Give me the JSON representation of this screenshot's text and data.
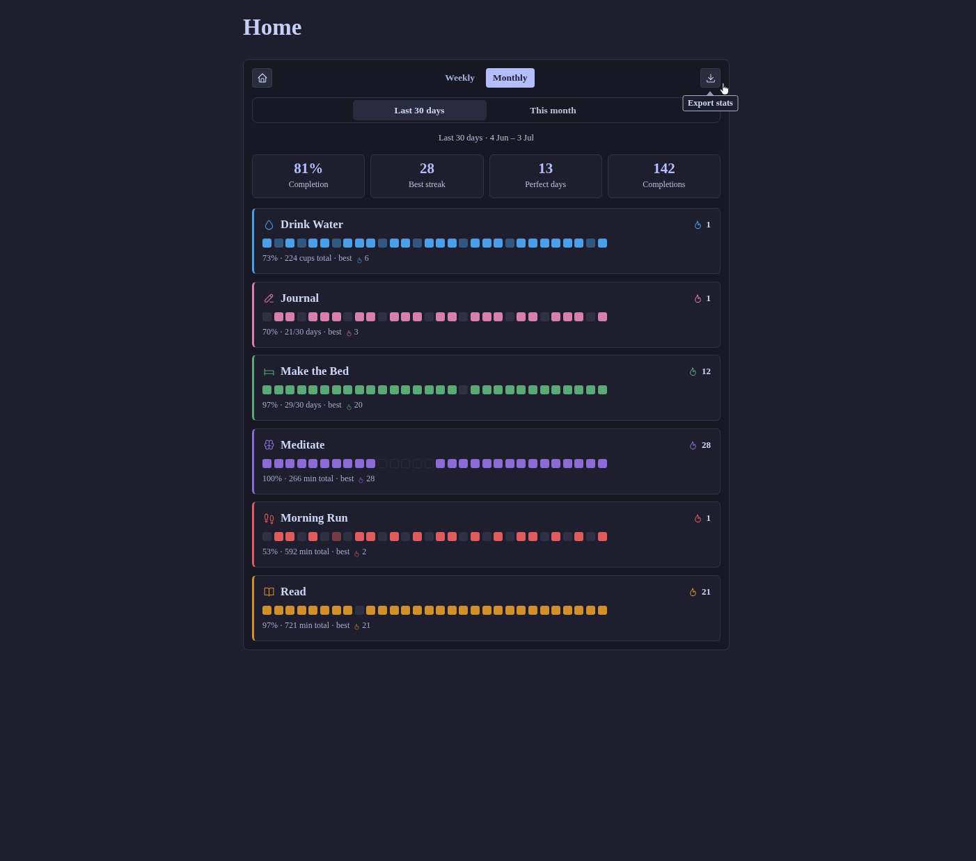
{
  "page": {
    "title": "Home"
  },
  "view_tabs": [
    {
      "label": "Weekly",
      "selected": false
    },
    {
      "label": "Monthly",
      "selected": true
    }
  ],
  "export_tooltip": "Export stats",
  "range_tabs": [
    {
      "label": "Last 30 days",
      "selected": true
    },
    {
      "label": "This month",
      "selected": false
    }
  ],
  "range_caption": "Last 30 days · 4 Jun – 3 Jul",
  "stats": [
    {
      "value": "81%",
      "label": "Completion"
    },
    {
      "value": "28",
      "label": "Best streak"
    },
    {
      "value": "13",
      "label": "Perfect days"
    },
    {
      "value": "142",
      "label": "Completions"
    }
  ],
  "habits": [
    {
      "kind": "drop",
      "name": "Drink Water",
      "color": "#4a9fe8",
      "streak": "1",
      "summary": "73% · 224 cups total · best",
      "best": "6",
      "days": [
        {
          "kind": "done"
        },
        {
          "kind": "partial"
        },
        {
          "kind": "done"
        },
        {
          "kind": "partial"
        },
        {
          "kind": "done"
        },
        {
          "kind": "done"
        },
        {
          "kind": "partial"
        },
        {
          "kind": "done"
        },
        {
          "kind": "done"
        },
        {
          "kind": "done"
        },
        {
          "kind": "partial"
        },
        {
          "kind": "done"
        },
        {
          "kind": "done"
        },
        {
          "kind": "partial"
        },
        {
          "kind": "done"
        },
        {
          "kind": "done"
        },
        {
          "kind": "done"
        },
        {
          "kind": "partial"
        },
        {
          "kind": "done"
        },
        {
          "kind": "done"
        },
        {
          "kind": "done"
        },
        {
          "kind": "partial"
        },
        {
          "kind": "done"
        },
        {
          "kind": "done"
        },
        {
          "kind": "done"
        },
        {
          "kind": "done"
        },
        {
          "kind": "done"
        },
        {
          "kind": "done"
        },
        {
          "kind": "partial"
        },
        {
          "kind": "done"
        }
      ]
    },
    {
      "kind": "pencil",
      "name": "Journal",
      "color": "#d77fae",
      "streak": "1",
      "summary": "70% · 21/30 days · best",
      "best": "3",
      "days": [
        {
          "kind": "missed"
        },
        {
          "kind": "done"
        },
        {
          "kind": "done"
        },
        {
          "kind": "missed"
        },
        {
          "kind": "done"
        },
        {
          "kind": "done"
        },
        {
          "kind": "done"
        },
        {
          "kind": "missed"
        },
        {
          "kind": "done"
        },
        {
          "kind": "done"
        },
        {
          "kind": "missed"
        },
        {
          "kind": "done"
        },
        {
          "kind": "done"
        },
        {
          "kind": "done"
        },
        {
          "kind": "missed"
        },
        {
          "kind": "done"
        },
        {
          "kind": "done"
        },
        {
          "kind": "missed"
        },
        {
          "kind": "done"
        },
        {
          "kind": "done"
        },
        {
          "kind": "done"
        },
        {
          "kind": "missed"
        },
        {
          "kind": "done"
        },
        {
          "kind": "done"
        },
        {
          "kind": "missed"
        },
        {
          "kind": "done"
        },
        {
          "kind": "done"
        },
        {
          "kind": "done"
        },
        {
          "kind": "missed"
        },
        {
          "kind": "done"
        }
      ]
    },
    {
      "kind": "bed",
      "name": "Make the Bed",
      "color": "#5aa977",
      "streak": "12",
      "summary": "97% · 29/30 days · best",
      "best": "20",
      "days": [
        {
          "kind": "done"
        },
        {
          "kind": "done"
        },
        {
          "kind": "done"
        },
        {
          "kind": "done"
        },
        {
          "kind": "done"
        },
        {
          "kind": "done"
        },
        {
          "kind": "done"
        },
        {
          "kind": "done"
        },
        {
          "kind": "done"
        },
        {
          "kind": "done"
        },
        {
          "kind": "done"
        },
        {
          "kind": "done"
        },
        {
          "kind": "done"
        },
        {
          "kind": "done"
        },
        {
          "kind": "done"
        },
        {
          "kind": "done"
        },
        {
          "kind": "done"
        },
        {
          "kind": "missed"
        },
        {
          "kind": "done"
        },
        {
          "kind": "done"
        },
        {
          "kind": "done"
        },
        {
          "kind": "done"
        },
        {
          "kind": "done"
        },
        {
          "kind": "done"
        },
        {
          "kind": "done"
        },
        {
          "kind": "done"
        },
        {
          "kind": "done"
        },
        {
          "kind": "done"
        },
        {
          "kind": "done"
        },
        {
          "kind": "done"
        }
      ]
    },
    {
      "kind": "brain",
      "name": "Meditate",
      "color": "#8b6cd6",
      "streak": "28",
      "summary": "100% · 266 min total · best",
      "best": "28",
      "days": [
        {
          "kind": "done"
        },
        {
          "kind": "done"
        },
        {
          "kind": "done"
        },
        {
          "kind": "done"
        },
        {
          "kind": "done"
        },
        {
          "kind": "done"
        },
        {
          "kind": "done"
        },
        {
          "kind": "done"
        },
        {
          "kind": "done"
        },
        {
          "kind": "done"
        },
        {
          "kind": "skipped"
        },
        {
          "kind": "skipped"
        },
        {
          "kind": "skipped"
        },
        {
          "kind": "skipped"
        },
        {
          "kind": "skipped"
        },
        {
          "kind": "done"
        },
        {
          "kind": "done"
        },
        {
          "kind": "done"
        },
        {
          "kind": "done"
        },
        {
          "kind": "done"
        },
        {
          "kind": "done"
        },
        {
          "kind": "done"
        },
        {
          "kind": "done"
        },
        {
          "kind": "done"
        },
        {
          "kind": "done"
        },
        {
          "kind": "done"
        },
        {
          "kind": "done"
        },
        {
          "kind": "done"
        },
        {
          "kind": "done"
        },
        {
          "kind": "done"
        }
      ]
    },
    {
      "kind": "footprints",
      "name": "Morning Run",
      "color": "#e05c5c",
      "streak": "1",
      "summary": "53% · 592 min total · best",
      "best": "2",
      "days": [
        {
          "kind": "missed"
        },
        {
          "kind": "done"
        },
        {
          "kind": "done"
        },
        {
          "kind": "missed"
        },
        {
          "kind": "done"
        },
        {
          "kind": "missed"
        },
        {
          "kind": "partial"
        },
        {
          "kind": "missed"
        },
        {
          "kind": "done"
        },
        {
          "kind": "done"
        },
        {
          "kind": "missed"
        },
        {
          "kind": "done"
        },
        {
          "kind": "missed"
        },
        {
          "kind": "done"
        },
        {
          "kind": "missed"
        },
        {
          "kind": "done"
        },
        {
          "kind": "done"
        },
        {
          "kind": "missed"
        },
        {
          "kind": "done"
        },
        {
          "kind": "missed"
        },
        {
          "kind": "done"
        },
        {
          "kind": "missed"
        },
        {
          "kind": "done"
        },
        {
          "kind": "done"
        },
        {
          "kind": "missed"
        },
        {
          "kind": "done"
        },
        {
          "kind": "missed"
        },
        {
          "kind": "done"
        },
        {
          "kind": "missed"
        },
        {
          "kind": "done"
        }
      ]
    },
    {
      "kind": "book",
      "name": "Read",
      "color": "#d0902c",
      "streak": "21",
      "summary": "97% · 721 min total · best",
      "best": "21",
      "days": [
        {
          "kind": "done"
        },
        {
          "kind": "done"
        },
        {
          "kind": "done"
        },
        {
          "kind": "done"
        },
        {
          "kind": "done"
        },
        {
          "kind": "done"
        },
        {
          "kind": "done"
        },
        {
          "kind": "done"
        },
        {
          "kind": "missed"
        },
        {
          "kind": "done"
        },
        {
          "kind": "done"
        },
        {
          "kind": "done"
        },
        {
          "kind": "done"
        },
        {
          "kind": "done"
        },
        {
          "kind": "done"
        },
        {
          "kind": "done"
        },
        {
          "kind": "done"
        },
        {
          "kind": "done"
        },
        {
          "kind": "done"
        },
        {
          "kind": "done"
        },
        {
          "kind": "done"
        },
        {
          "kind": "done"
        },
        {
          "kind": "done"
        },
        {
          "kind": "done"
        },
        {
          "kind": "done"
        },
        {
          "kind": "done"
        },
        {
          "kind": "done"
        },
        {
          "kind": "done"
        },
        {
          "kind": "done"
        },
        {
          "kind": "done"
        }
      ]
    }
  ]
}
